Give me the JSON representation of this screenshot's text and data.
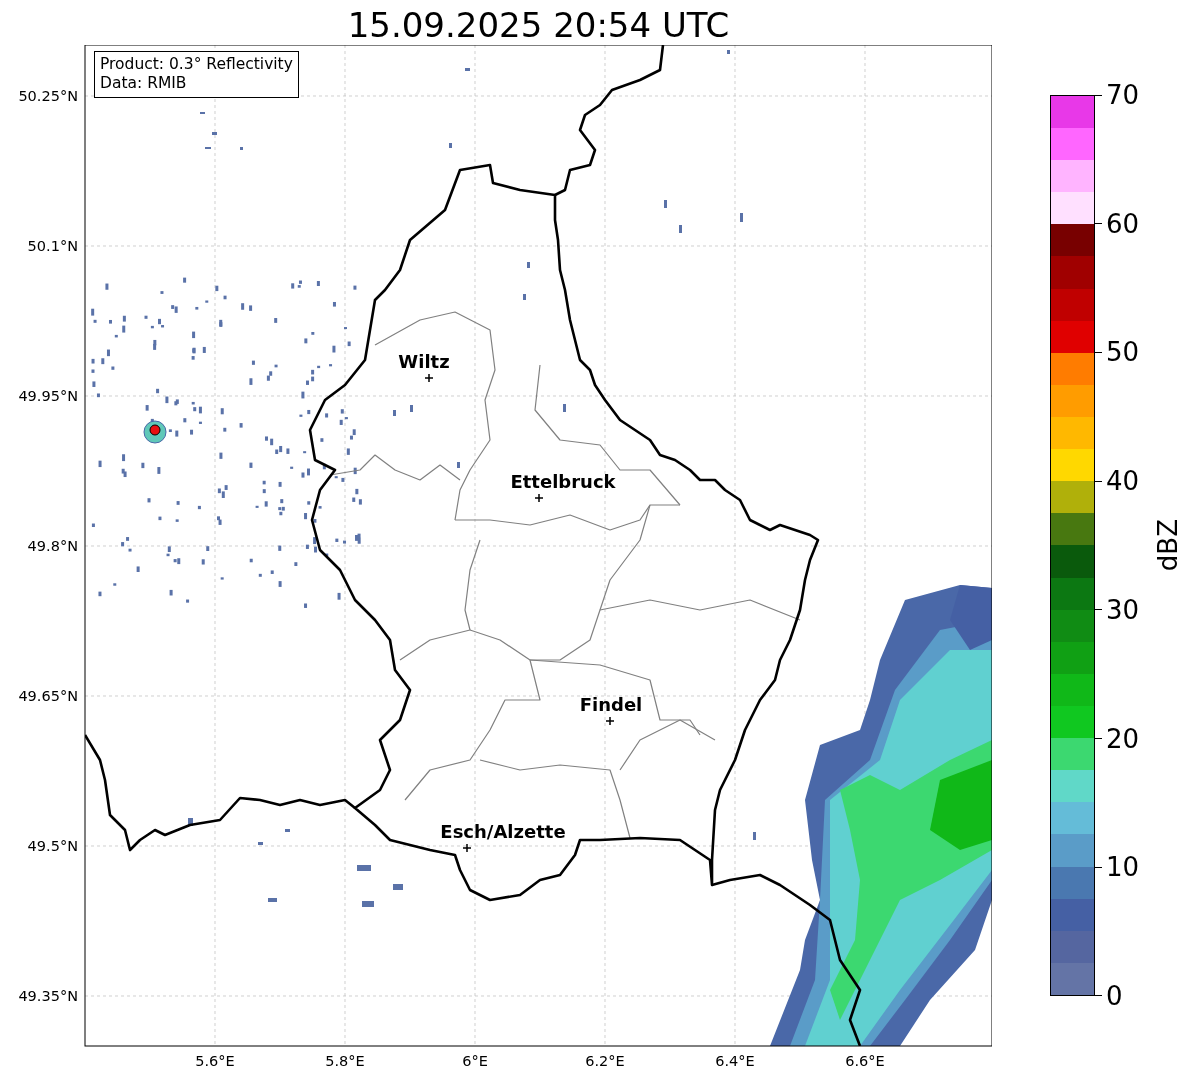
{
  "title": "15.09.2025 20:54 UTC",
  "info_box": {
    "lines": [
      "Product: 0.3° Reflectivity",
      "Data: RMIB"
    ]
  },
  "map": {
    "yticks": [
      "50.25°N",
      "50.1°N",
      "49.95°N",
      "49.8°N",
      "49.65°N",
      "49.5°N",
      "49.35°N"
    ],
    "xticks": [
      "5.6°E",
      "5.8°E",
      "6°E",
      "6.2°E",
      "6.4°E",
      "6.6°E"
    ],
    "cities": [
      {
        "name": "Wiltz"
      },
      {
        "name": "Ettelbruck"
      },
      {
        "name": "Findel"
      },
      {
        "name": "Esch/Alzette"
      }
    ]
  },
  "colorbar": {
    "label": "dBZ",
    "ticks": [
      "70",
      "60",
      "50",
      "40",
      "30",
      "20",
      "10",
      "0"
    ],
    "bins": [
      {
        "color": "#6474a6"
      },
      {
        "color": "#5566a0"
      },
      {
        "color": "#4560a4"
      },
      {
        "color": "#4a78b0"
      },
      {
        "color": "#5a9cc8"
      },
      {
        "color": "#64bcd8"
      },
      {
        "color": "#60d8c8"
      },
      {
        "color": "#3cd870"
      },
      {
        "color": "#10c820"
      },
      {
        "color": "#10b818"
      },
      {
        "color": "#10a014"
      },
      {
        "color": "#108c14"
      },
      {
        "color": "#0c7812"
      },
      {
        "color": "#0a5a0c"
      },
      {
        "color": "#487810"
      },
      {
        "color": "#b0b00a"
      },
      {
        "color": "#ffd800"
      },
      {
        "color": "#ffb800"
      },
      {
        "color": "#ff9c00"
      },
      {
        "color": "#ff7c00"
      },
      {
        "color": "#e00000"
      },
      {
        "color": "#c00000"
      },
      {
        "color": "#a00000"
      },
      {
        "color": "#780000"
      },
      {
        "color": "#ffe0ff"
      },
      {
        "color": "#ffb4ff"
      },
      {
        "color": "#ff66ff"
      },
      {
        "color": "#e838e8"
      }
    ]
  }
}
